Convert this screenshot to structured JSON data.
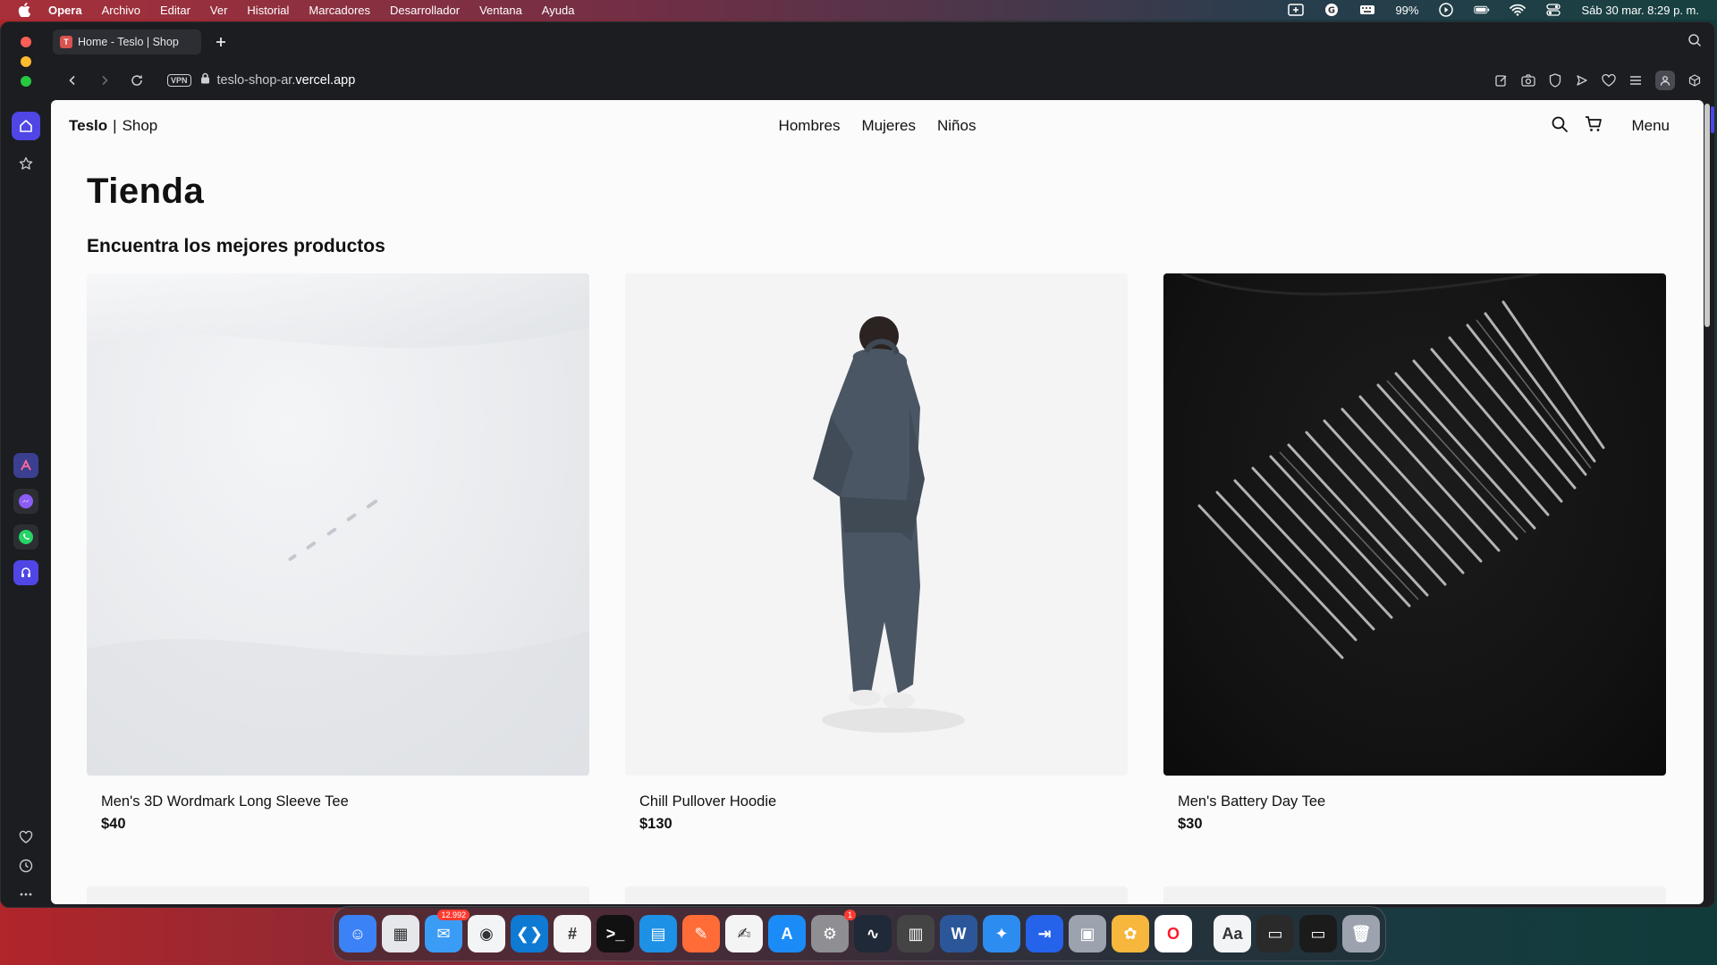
{
  "menubar": {
    "app_name": "Opera",
    "items": [
      "Archivo",
      "Editar",
      "Ver",
      "Historial",
      "Marcadores",
      "Desarrollador",
      "Ventana",
      "Ayuda"
    ],
    "battery": "99%",
    "datetime": "Sáb 30 mar.  8:29 p. m."
  },
  "browser": {
    "tab_title": "Home - Teslo | Shop",
    "tab_favicon": "T",
    "vpn_label": "VPN",
    "url_prefix": "teslo-shop-ar.",
    "url_domain": "vercel.app"
  },
  "site": {
    "brand": "Teslo",
    "brand_suffix": "Shop",
    "nav": [
      "Hombres",
      "Mujeres",
      "Niños"
    ],
    "menu_label": "Menu",
    "title": "Tienda",
    "subtitle": "Encuentra los mejores productos",
    "products": [
      {
        "name": "Men's 3D Wordmark Long Sleeve Tee",
        "price": "$40"
      },
      {
        "name": "Chill Pullover Hoodie",
        "price": "$130"
      },
      {
        "name": "Men's Battery Day Tee",
        "price": "$30"
      }
    ]
  },
  "dock": {
    "apps": [
      {
        "icon": "finder-icon",
        "color": "#3b82f6"
      },
      {
        "icon": "launchpad-icon",
        "color": "#e5e7eb"
      },
      {
        "icon": "mail-icon",
        "color": "#3b9cf6",
        "badge": "12.992"
      },
      {
        "icon": "chrome-icon",
        "color": "#f3f4f6"
      },
      {
        "icon": "vscode-icon",
        "color": "#0e7ad3"
      },
      {
        "icon": "slack-icon",
        "color": "#f5f5f5"
      },
      {
        "icon": "terminal-icon",
        "color": "#111111"
      },
      {
        "icon": "docker-icon",
        "color": "#1d91e6"
      },
      {
        "icon": "postman-icon",
        "color": "#ff6c37"
      },
      {
        "icon": "textedit-icon",
        "color": "#f4f4f4"
      },
      {
        "icon": "appstore-icon",
        "color": "#1b8cf7"
      },
      {
        "icon": "system-settings-icon",
        "color": "#8e8e93",
        "badge": "1"
      },
      {
        "icon": "activity-monitor-icon",
        "color": "#1f2937"
      },
      {
        "icon": "calculator-icon",
        "color": "#444444"
      },
      {
        "icon": "word-icon",
        "color": "#2b579a"
      },
      {
        "icon": "safari-icon",
        "color": "#2d8cf0"
      },
      {
        "icon": "remote-desktop-icon",
        "color": "#2563eb"
      },
      {
        "icon": "preview-icon",
        "color": "#9ca3af"
      },
      {
        "icon": "keka-icon",
        "color": "#f6b73c"
      },
      {
        "icon": "opera-icon",
        "color": "#ffffff"
      }
    ],
    "recent": [
      {
        "icon": "font-book-icon",
        "color": "#f3f4f6"
      },
      {
        "icon": "window-thumb-icon",
        "color": "#2a2a2a"
      },
      {
        "icon": "window-thumb-icon",
        "color": "#1b1b1b"
      },
      {
        "icon": "trash-icon",
        "color": "#9ca3af"
      }
    ]
  }
}
